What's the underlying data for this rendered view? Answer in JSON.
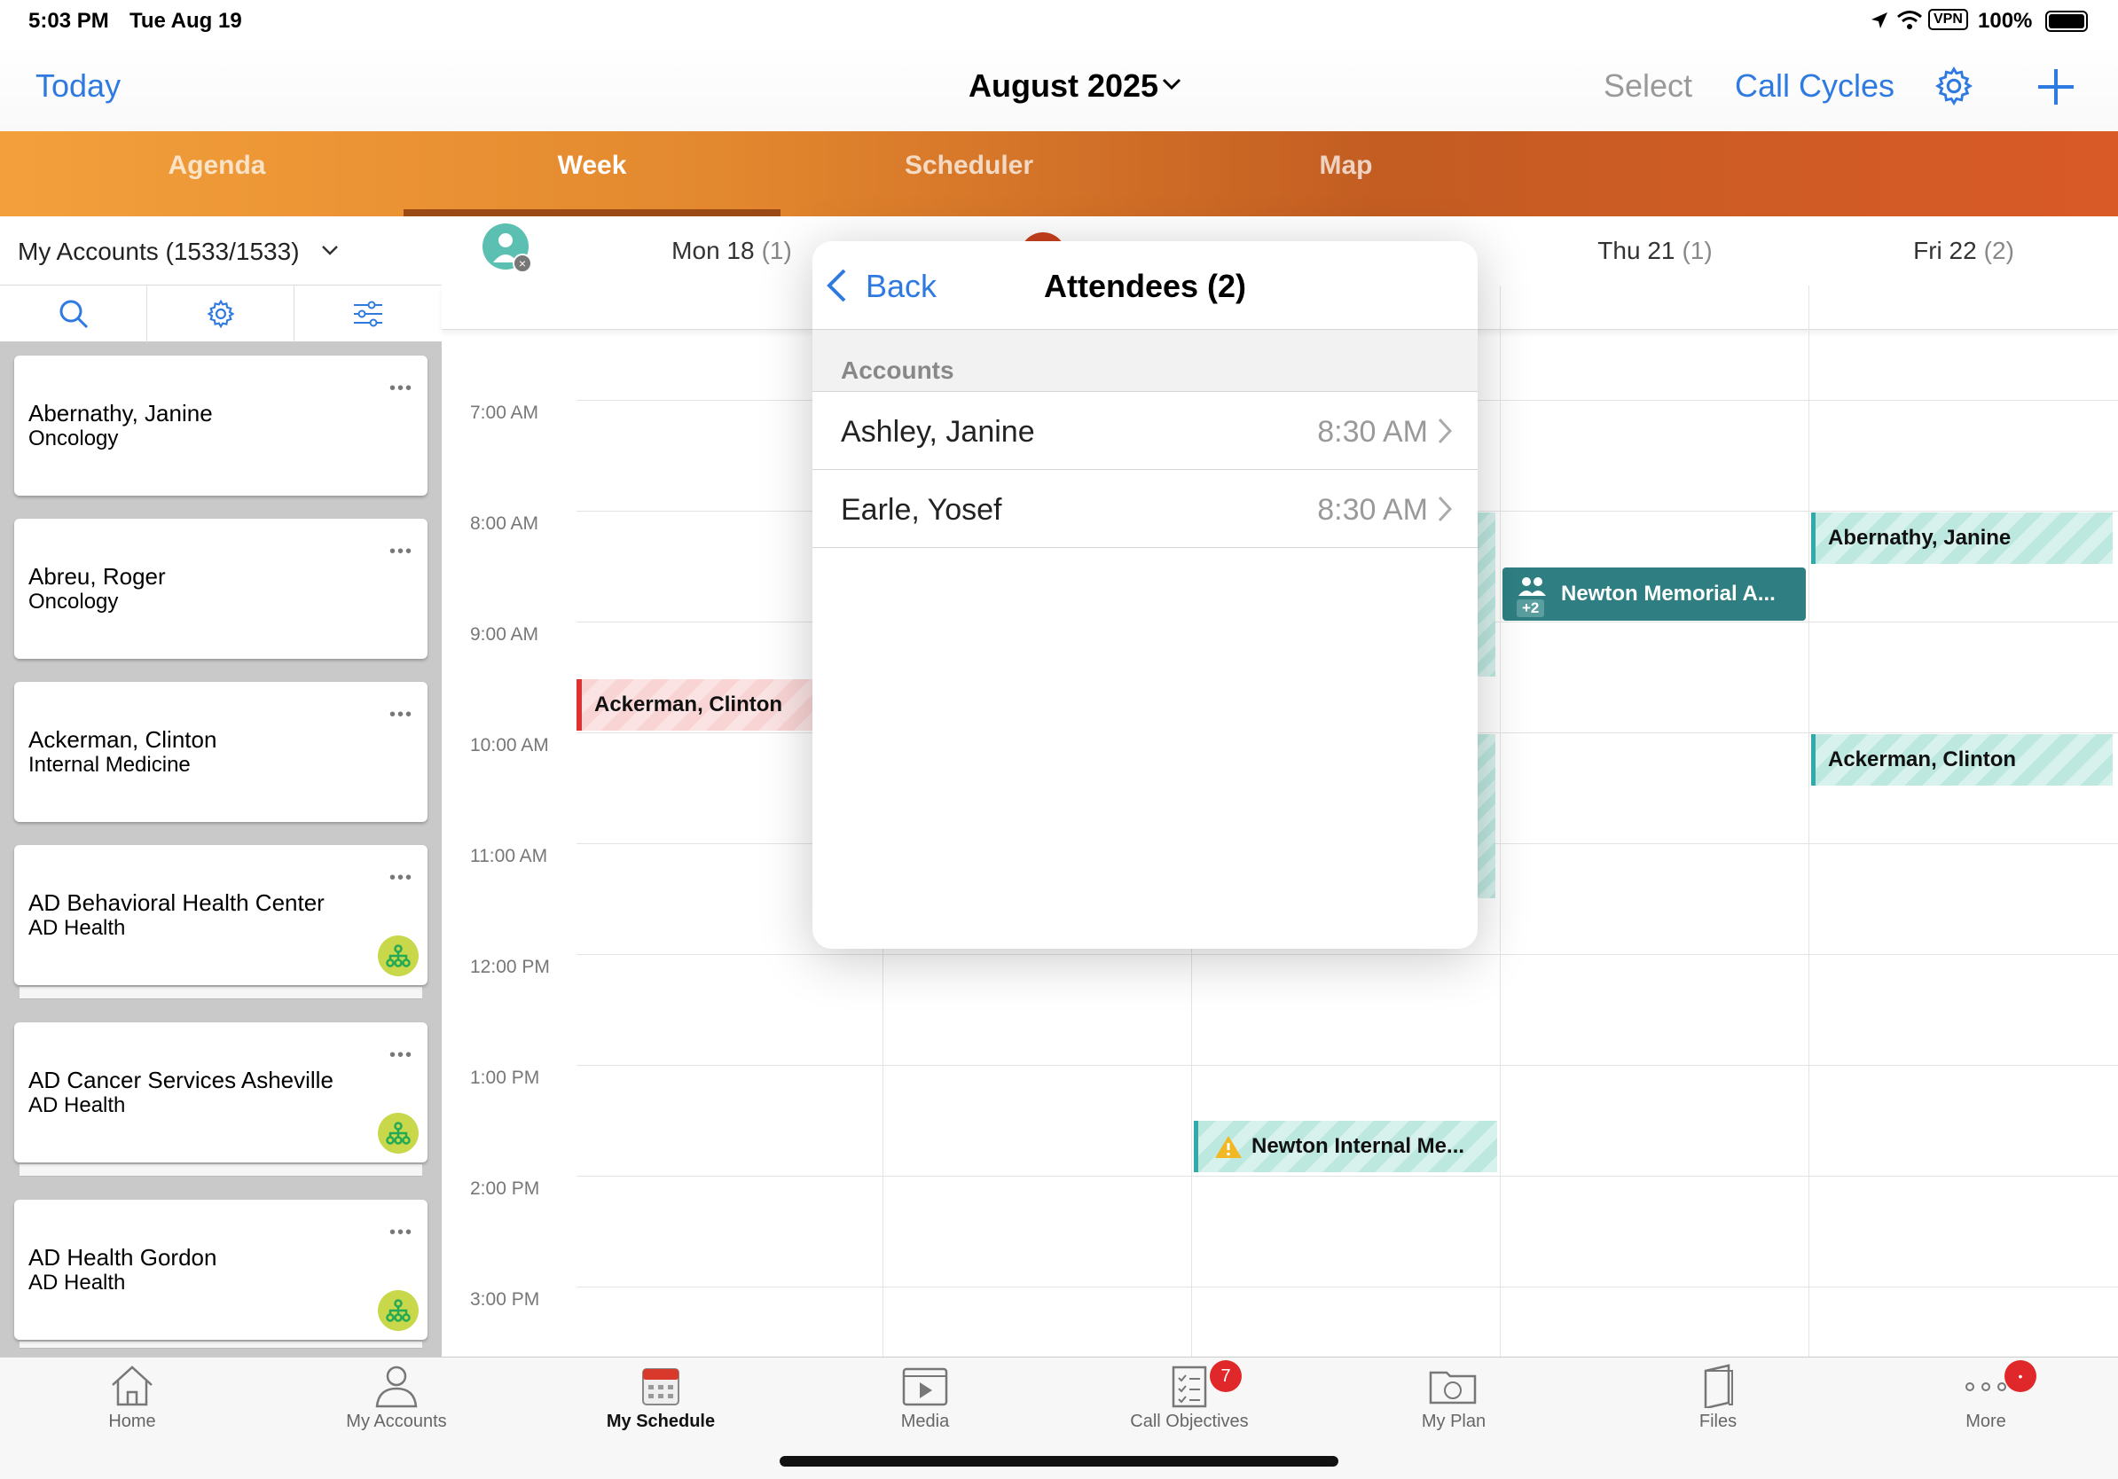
{
  "status": {
    "time": "5:03 PM",
    "date": "Tue Aug 19",
    "vpn": "VPN",
    "battery": "100%"
  },
  "nav": {
    "today": "Today",
    "title": "August 2025",
    "select": "Select",
    "call_cycles": "Call Cycles"
  },
  "tabs": [
    {
      "label": "Agenda"
    },
    {
      "label": "Week"
    },
    {
      "label": "Scheduler"
    },
    {
      "label": "Map"
    }
  ],
  "accounts_header": "My Accounts (1533/1533)",
  "accounts": [
    {
      "name": "Abernathy, Janine",
      "specialty": "Oncology"
    },
    {
      "name": "Abreu, Roger",
      "specialty": "Oncology"
    },
    {
      "name": "Ackerman, Clinton",
      "specialty": "Internal Medicine"
    },
    {
      "name": "AD Behavioral Health Center",
      "specialty": "AD Health"
    },
    {
      "name": "AD Cancer Services Asheville",
      "specialty": "AD Health"
    },
    {
      "name": "AD Health Gordon",
      "specialty": "AD Health"
    }
  ],
  "card_dots": "•••",
  "days": [
    {
      "label": "Mon 18",
      "count": "(1)"
    },
    {
      "label": "Thu 21",
      "count": "(1)"
    },
    {
      "label": "Fri 22",
      "count": "(2)"
    }
  ],
  "times": [
    "7:00 AM",
    "8:00 AM",
    "9:00 AM",
    "10:00 AM",
    "11:00 AM",
    "12:00 PM",
    "1:00 PM",
    "2:00 PM",
    "3:00 PM"
  ],
  "events": {
    "mon_ackerman": "Ackerman, Clinton",
    "thu_newton": "Newton Memorial A...",
    "thu_newton_more": "+2",
    "fri_abernathy": "Abernathy, Janine",
    "fri_ackerman": "Ackerman, Clinton",
    "wed_newton_internal": "Newton Internal Me..."
  },
  "popover": {
    "back": "Back",
    "title": "Attendees (2)",
    "section": "Accounts",
    "rows": [
      {
        "name": "Ashley, Janine",
        "time": "8:30 AM"
      },
      {
        "name": "Earle, Yosef",
        "time": "8:30 AM"
      }
    ]
  },
  "bottom_tabs": [
    {
      "label": "Home"
    },
    {
      "label": "My Accounts"
    },
    {
      "label": "My Schedule"
    },
    {
      "label": "Media"
    },
    {
      "label": "Call Objectives",
      "badge": "7"
    },
    {
      "label": "My Plan"
    },
    {
      "label": "Files"
    },
    {
      "label": "More",
      "badge": "•"
    }
  ],
  "colors": {
    "accent": "#2f7ae0",
    "tab_orange": "#e2872e",
    "event_teal": "#2f7f82",
    "event_red": "#dd3333",
    "badge_red": "#e0282a"
  }
}
